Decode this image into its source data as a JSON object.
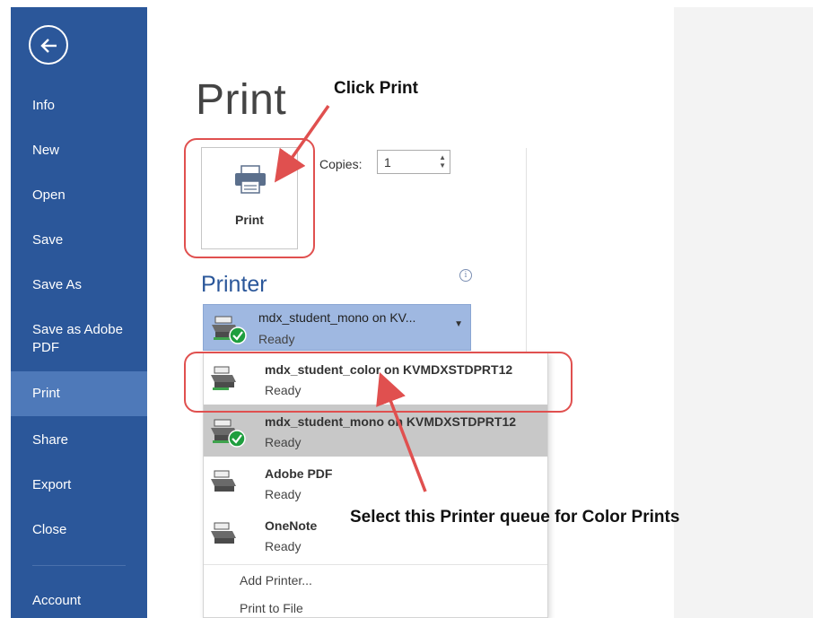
{
  "nav": {
    "items": [
      {
        "label": "Info"
      },
      {
        "label": "New"
      },
      {
        "label": "Open"
      },
      {
        "label": "Save"
      },
      {
        "label": "Save As"
      },
      {
        "label": "Save as Adobe PDF"
      },
      {
        "label": "Print"
      },
      {
        "label": "Share"
      },
      {
        "label": "Export"
      },
      {
        "label": "Close"
      },
      {
        "label": "Account"
      }
    ],
    "active": "Print"
  },
  "main": {
    "title": "Print",
    "print_button_label": "Print",
    "copies_label": "Copies:",
    "copies_value": "1",
    "printer_heading": "Printer",
    "info_icon_glyph": "i",
    "selected_printer": {
      "name": "mdx_student_mono on KV...",
      "status": "Ready"
    },
    "printers": [
      {
        "name": "mdx_student_color on KVMDXSTDPRT12",
        "status": "Ready",
        "icon": "printer-icon"
      },
      {
        "name": "mdx_student_mono on KVMDXSTDPRT12",
        "status": "Ready",
        "icon": "printer-default-icon"
      },
      {
        "name": "Adobe PDF",
        "status": "Ready",
        "icon": "printer-icon"
      },
      {
        "name": "OneNote",
        "status": "Ready",
        "icon": "printer-icon"
      }
    ],
    "actions": [
      "Add Printer...",
      "Print to File"
    ]
  },
  "annotations": {
    "click_print": "Click Print",
    "select_queue": "Select this Printer queue for Color Prints"
  },
  "colors": {
    "nav_bg": "#2b579a",
    "nav_active": "#4e79b9",
    "accent": "#2b579a",
    "annotation": "#e0504f"
  }
}
